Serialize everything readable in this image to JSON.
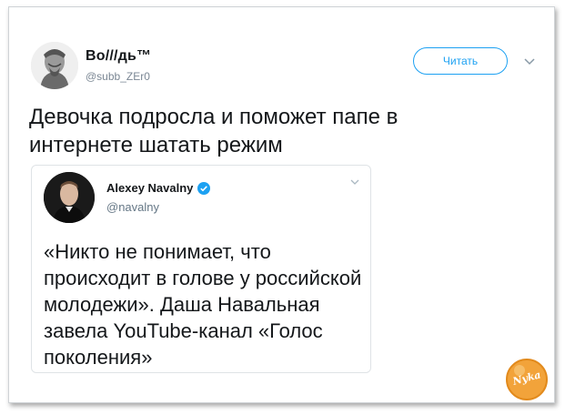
{
  "tweet": {
    "author_name": "Bo///дь™",
    "author_handle": "@subb_ZEr0",
    "follow_label": "Читать",
    "text": "Девочка подросла и поможет папе в интернете шатать режим"
  },
  "quoted_tweet": {
    "author_name": "Alexey Navalny",
    "author_handle": "@navalny",
    "verified": true,
    "text": "«Никто не понимает, что происходит в голове у российской молодежи». Даша Навальная завела YouTube-канал «Голос поколения»"
  },
  "watermark": {
    "text": "Nyka"
  },
  "colors": {
    "accent": "#1da1f2",
    "text_primary": "#14171a",
    "text_secondary": "#657786",
    "border": "#dfe3e6",
    "watermark": "#f2a33a"
  },
  "icons": {
    "more": "chevron-down-icon",
    "verified": "verified-badge-icon"
  }
}
